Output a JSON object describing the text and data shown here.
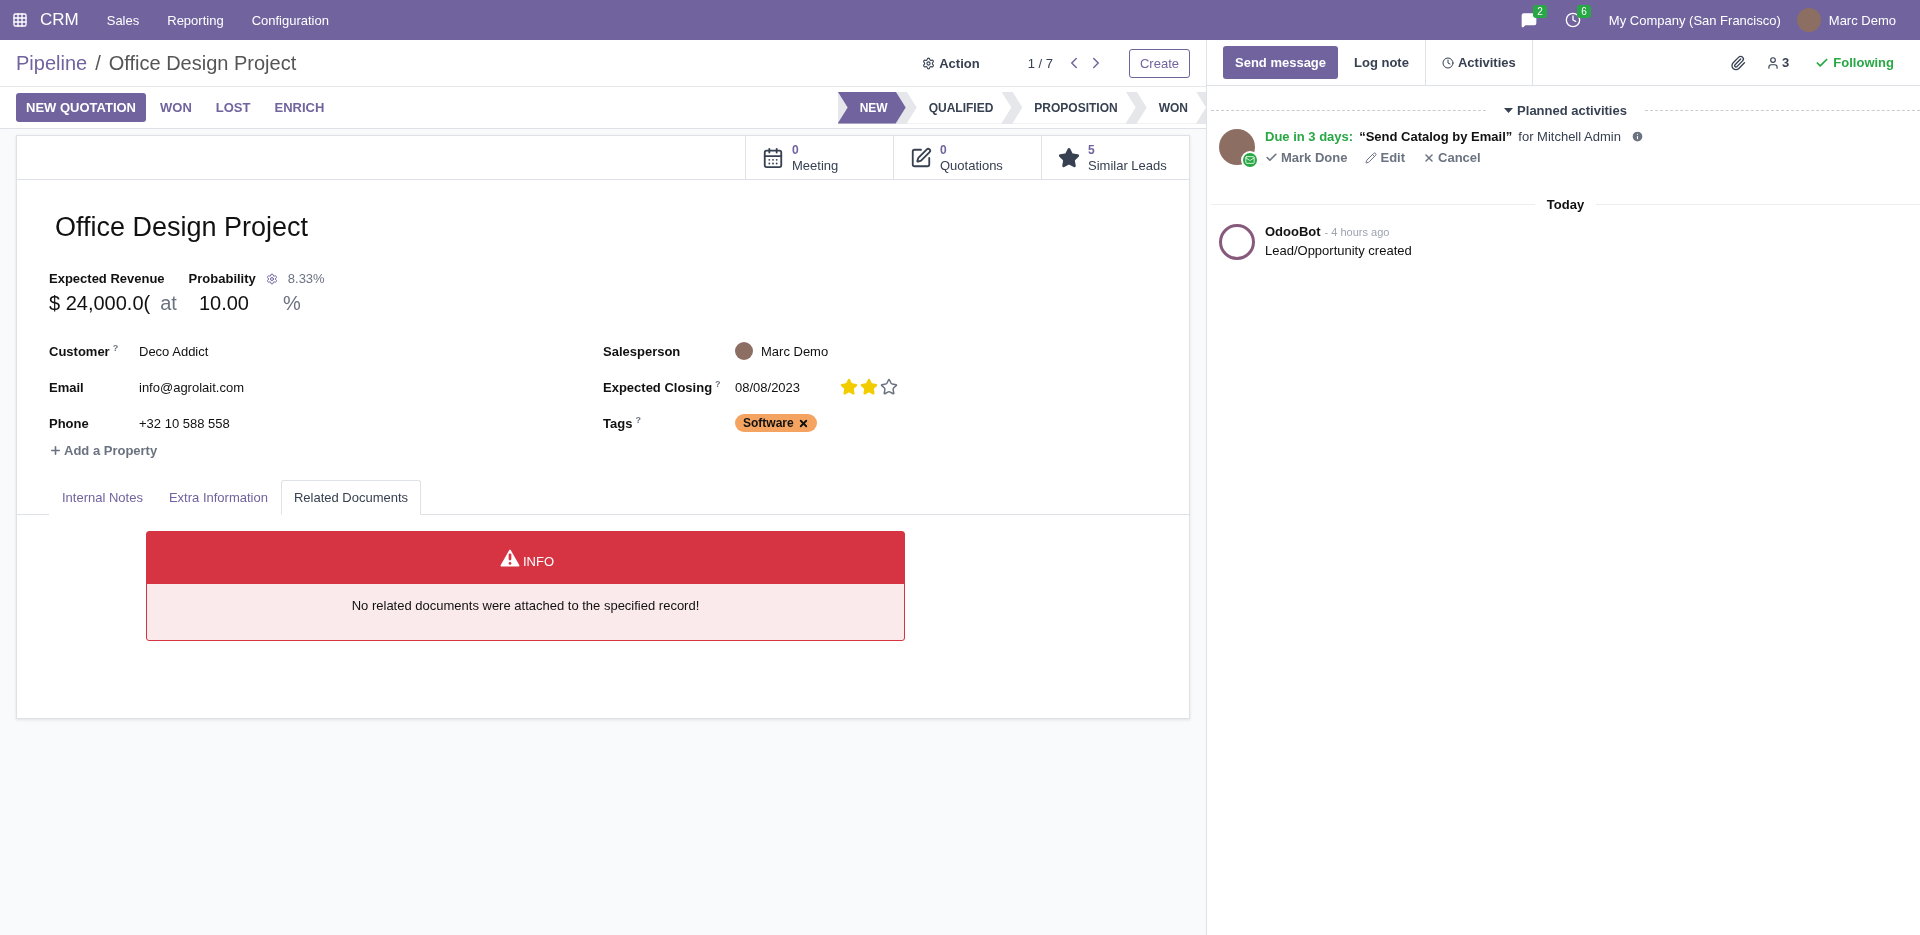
{
  "navbar": {
    "app": "CRM",
    "menus": [
      "Sales",
      "Reporting",
      "Configuration"
    ],
    "messages_count": "2",
    "activities_count": "6",
    "company": "My Company (San Francisco)",
    "user": "Marc Demo"
  },
  "breadcrumb": {
    "parent": "Pipeline",
    "separator": "/",
    "current": "Office Design Project"
  },
  "control": {
    "action": "Action",
    "pager": "1 / 7",
    "create": "Create"
  },
  "buttons": [
    {
      "label": "NEW QUOTATION",
      "primary": true
    },
    {
      "label": "WON",
      "primary": false
    },
    {
      "label": "LOST",
      "primary": false
    },
    {
      "label": "ENRICH",
      "primary": false
    }
  ],
  "stages": [
    {
      "label": "NEW",
      "selected": true
    },
    {
      "label": "QUALIFIED",
      "selected": false
    },
    {
      "label": "PROPOSITION",
      "selected": false
    },
    {
      "label": "WON",
      "selected": false
    }
  ],
  "smart_buttons": [
    {
      "kind": "calendar",
      "count": "0",
      "label": "Meeting"
    },
    {
      "kind": "quote",
      "count": "0",
      "label": "Quotations"
    },
    {
      "kind": "star",
      "count": "5",
      "label": "Similar Leads"
    }
  ],
  "record": {
    "title": "Office Design Project",
    "revenue_label": "Expected Revenue",
    "probability_label": "Probability",
    "probability_auto": "8.33%",
    "revenue": "$ 24,000.0(",
    "at": "at",
    "probability": "10.00",
    "percent": "%"
  },
  "left_fields": [
    {
      "label": "Customer",
      "help": "?",
      "value": "Deco Addict"
    },
    {
      "label": "Email",
      "value": "info@agrolait.com"
    },
    {
      "label": "Phone",
      "value": "+32 10 588 558"
    }
  ],
  "add_property": "Add a Property",
  "salesperson": {
    "label": "Salesperson",
    "value": "Marc Demo"
  },
  "expected_closing": {
    "label": "Expected Closing",
    "help": "?",
    "value": "08/08/2023",
    "stars": 2
  },
  "tags": {
    "label": "Tags",
    "help": "?",
    "items": [
      {
        "label": "Software",
        "color": "#f4a460"
      }
    ]
  },
  "tabs": [
    {
      "label": "Internal Notes",
      "selected": false
    },
    {
      "label": "Extra Information",
      "selected": false
    },
    {
      "label": "Related Documents",
      "selected": true
    }
  ],
  "alert": {
    "title": "INFO",
    "message": "No related documents were attached to the specified record!"
  },
  "chatter": {
    "send_message": "Send message",
    "log_note": "Log note",
    "activities": "Activities",
    "followers": "3",
    "following": "Following",
    "planned_title": "Planned activities",
    "activity": {
      "due": "Due in 3 days:",
      "summary": "“Send Catalog by Email”",
      "assignee": "for Mitchell Admin",
      "mark_done": "Mark Done",
      "edit": "Edit",
      "cancel": "Cancel"
    },
    "today": "Today",
    "messages": [
      {
        "author": "OdooBot",
        "time": "- 4 hours ago",
        "body": "Lead/Opportunity created"
      }
    ]
  }
}
